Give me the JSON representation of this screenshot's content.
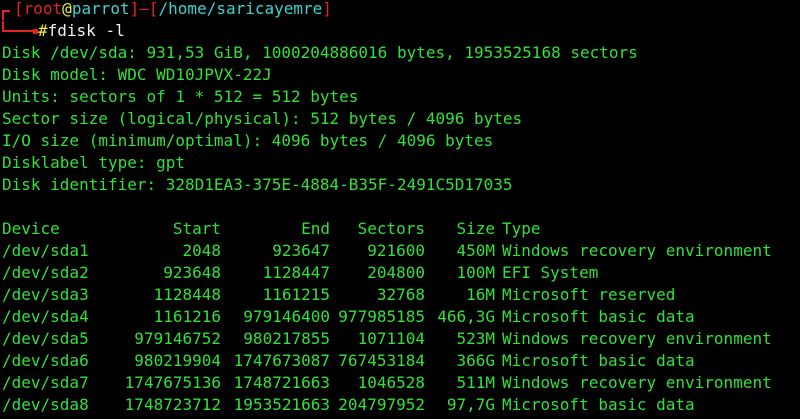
{
  "colors": {
    "background": "#000000",
    "text": "#33e03a",
    "bracket": "#e52222",
    "user": "#e52222",
    "host": "#3fd1d1",
    "path": "#3fd1d1",
    "hash": "#f2f23a",
    "command": "#f0f0f0"
  },
  "prompt": {
    "open_bracket": "[",
    "user": "root",
    "at": "@",
    "host": "parrot",
    "close_bracket": "]",
    "dash": "—",
    "path_open": "[",
    "path": "/home/saricayemre",
    "path_close": "]",
    "hash": "#",
    "command": "fdisk -l"
  },
  "disk_info": [
    "Disk /dev/sda: 931,53 GiB, 1000204886016 bytes, 1953525168 sectors",
    "Disk model: WDC WD10JPVX-22J",
    "Units: sectors of 1 * 512 = 512 bytes",
    "Sector size (logical/physical): 512 bytes / 4096 bytes",
    "I/O size (minimum/optimal): 4096 bytes / 4096 bytes",
    "Disklabel type: gpt",
    "Disk identifier: 328D1EA3-375E-4884-B35F-2491C5D17035"
  ],
  "table": {
    "headers": [
      "Device",
      "Start",
      "End",
      "Sectors",
      "Size",
      "Type"
    ],
    "rows": [
      [
        "/dev/sda1",
        "2048",
        "923647",
        "921600",
        "450M",
        "Windows recovery environment"
      ],
      [
        "/dev/sda2",
        "923648",
        "1128447",
        "204800",
        "100M",
        "EFI System"
      ],
      [
        "/dev/sda3",
        "1128448",
        "1161215",
        "32768",
        "16M",
        "Microsoft reserved"
      ],
      [
        "/dev/sda4",
        "1161216",
        "979146400",
        "977985185",
        "466,3G",
        "Microsoft basic data"
      ],
      [
        "/dev/sda5",
        "979146752",
        "980217855",
        "1071104",
        "523M",
        "Windows recovery environment"
      ],
      [
        "/dev/sda6",
        "980219904",
        "1747673087",
        "767453184",
        "366G",
        "Microsoft basic data"
      ],
      [
        "/dev/sda7",
        "1747675136",
        "1748721663",
        "1046528",
        "511M",
        "Windows recovery environment"
      ],
      [
        "/dev/sda8",
        "1748723712",
        "1953521663",
        "204797952",
        "97,7G",
        "Microsoft basic data"
      ]
    ]
  }
}
